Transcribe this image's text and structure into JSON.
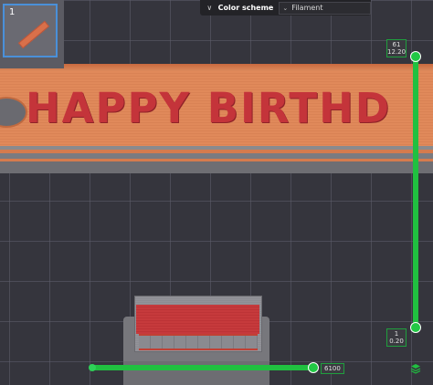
{
  "plate_thumbnail": {
    "number": "1"
  },
  "color_scheme": {
    "label": "Color scheme",
    "selected": "Filament"
  },
  "model": {
    "text": "HAPPY BIRTHD",
    "colors": {
      "face": "#e0895a",
      "letters": "#c4343a",
      "accent": "#20c040"
    }
  },
  "layer_slider": {
    "top_layer": "61",
    "top_height": "12.20",
    "bottom_layer": "1",
    "bottom_height": "0.20"
  },
  "move_slider": {
    "value": "6100"
  }
}
